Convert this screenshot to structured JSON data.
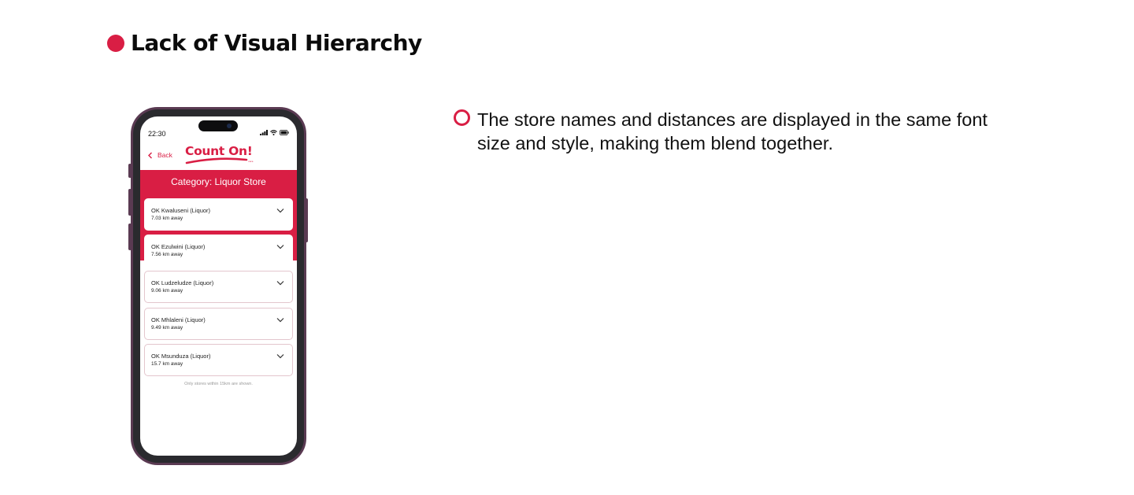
{
  "heading": {
    "text": "Lack of Visual Hierarchy",
    "accent": "#d91e44"
  },
  "bullet": {
    "text": "The store names and distances are displayed in the same font size and style, making them blend together."
  },
  "phone": {
    "status": {
      "time": "22:30"
    },
    "header": {
      "back_label": "Back",
      "logo_text": "Count On!"
    },
    "category_title": "Category: Liquor Store",
    "stores": [
      {
        "name": "OK Kwaluseni (Liquor)",
        "distance": "7.03 km away"
      },
      {
        "name": "OK Ezulwini (Liquor)",
        "distance": "7.56 km away"
      },
      {
        "name": "OK Ludzeludze (Liquor)",
        "distance": "9.06 km away"
      },
      {
        "name": "OK Mhlaleni (Liquor)",
        "distance": "9.49 km away"
      },
      {
        "name": "OK Msunduza (Liquor)",
        "distance": "15.7 km away"
      }
    ],
    "footer_note": "Only stores within 15km are shown."
  },
  "icons": {
    "back": "chevron-left-icon",
    "expand": "chevron-down-icon",
    "signal": "signal-icon",
    "wifi": "wifi-icon",
    "battery": "battery-icon"
  }
}
